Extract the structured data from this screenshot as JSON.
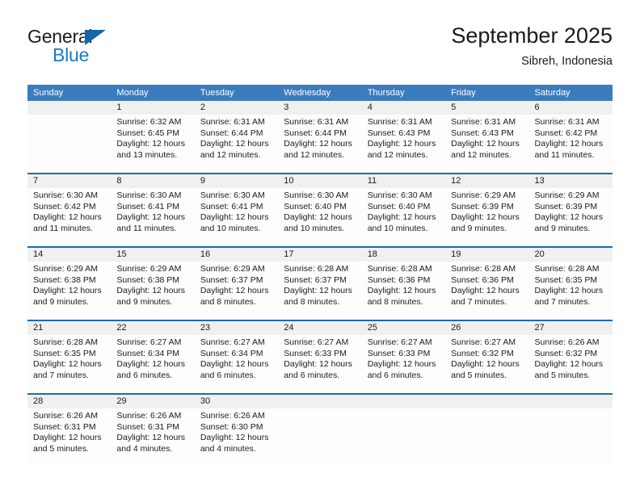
{
  "brand": {
    "name_top": "General",
    "name_bottom": "Blue"
  },
  "header": {
    "title": "September 2025",
    "subtitle": "Sibreh, Indonesia"
  },
  "colors": {
    "header_blue": "#3a7cbe",
    "separator_blue": "#1b6cb0",
    "datenum_bg": "#f0f0f0",
    "logo_blue": "#1b79c4",
    "text": "#1b1b1b"
  },
  "calendar": {
    "day_headers": [
      "Sunday",
      "Monday",
      "Tuesday",
      "Wednesday",
      "Thursday",
      "Friday",
      "Saturday"
    ],
    "labels": {
      "sunrise": "Sunrise:",
      "sunset": "Sunset:",
      "daylight": "Daylight:"
    },
    "weeks": [
      {
        "days": [
          {
            "date": "",
            "sunrise": "",
            "sunset": "",
            "daylight": "",
            "empty": true
          },
          {
            "date": "1",
            "sunrise": "Sunrise: 6:32 AM",
            "sunset": "Sunset: 6:45 PM",
            "daylight": "Daylight: 12 hours and 13 minutes."
          },
          {
            "date": "2",
            "sunrise": "Sunrise: 6:31 AM",
            "sunset": "Sunset: 6:44 PM",
            "daylight": "Daylight: 12 hours and 12 minutes."
          },
          {
            "date": "3",
            "sunrise": "Sunrise: 6:31 AM",
            "sunset": "Sunset: 6:44 PM",
            "daylight": "Daylight: 12 hours and 12 minutes."
          },
          {
            "date": "4",
            "sunrise": "Sunrise: 6:31 AM",
            "sunset": "Sunset: 6:43 PM",
            "daylight": "Daylight: 12 hours and 12 minutes."
          },
          {
            "date": "5",
            "sunrise": "Sunrise: 6:31 AM",
            "sunset": "Sunset: 6:43 PM",
            "daylight": "Daylight: 12 hours and 12 minutes."
          },
          {
            "date": "6",
            "sunrise": "Sunrise: 6:31 AM",
            "sunset": "Sunset: 6:42 PM",
            "daylight": "Daylight: 12 hours and 11 minutes."
          }
        ]
      },
      {
        "days": [
          {
            "date": "7",
            "sunrise": "Sunrise: 6:30 AM",
            "sunset": "Sunset: 6:42 PM",
            "daylight": "Daylight: 12 hours and 11 minutes."
          },
          {
            "date": "8",
            "sunrise": "Sunrise: 6:30 AM",
            "sunset": "Sunset: 6:41 PM",
            "daylight": "Daylight: 12 hours and 11 minutes."
          },
          {
            "date": "9",
            "sunrise": "Sunrise: 6:30 AM",
            "sunset": "Sunset: 6:41 PM",
            "daylight": "Daylight: 12 hours and 10 minutes."
          },
          {
            "date": "10",
            "sunrise": "Sunrise: 6:30 AM",
            "sunset": "Sunset: 6:40 PM",
            "daylight": "Daylight: 12 hours and 10 minutes."
          },
          {
            "date": "11",
            "sunrise": "Sunrise: 6:30 AM",
            "sunset": "Sunset: 6:40 PM",
            "daylight": "Daylight: 12 hours and 10 minutes."
          },
          {
            "date": "12",
            "sunrise": "Sunrise: 6:29 AM",
            "sunset": "Sunset: 6:39 PM",
            "daylight": "Daylight: 12 hours and 9 minutes."
          },
          {
            "date": "13",
            "sunrise": "Sunrise: 6:29 AM",
            "sunset": "Sunset: 6:39 PM",
            "daylight": "Daylight: 12 hours and 9 minutes."
          }
        ]
      },
      {
        "days": [
          {
            "date": "14",
            "sunrise": "Sunrise: 6:29 AM",
            "sunset": "Sunset: 6:38 PM",
            "daylight": "Daylight: 12 hours and 9 minutes."
          },
          {
            "date": "15",
            "sunrise": "Sunrise: 6:29 AM",
            "sunset": "Sunset: 6:38 PM",
            "daylight": "Daylight: 12 hours and 9 minutes."
          },
          {
            "date": "16",
            "sunrise": "Sunrise: 6:29 AM",
            "sunset": "Sunset: 6:37 PM",
            "daylight": "Daylight: 12 hours and 8 minutes."
          },
          {
            "date": "17",
            "sunrise": "Sunrise: 6:28 AM",
            "sunset": "Sunset: 6:37 PM",
            "daylight": "Daylight: 12 hours and 8 minutes."
          },
          {
            "date": "18",
            "sunrise": "Sunrise: 6:28 AM",
            "sunset": "Sunset: 6:36 PM",
            "daylight": "Daylight: 12 hours and 8 minutes."
          },
          {
            "date": "19",
            "sunrise": "Sunrise: 6:28 AM",
            "sunset": "Sunset: 6:36 PM",
            "daylight": "Daylight: 12 hours and 7 minutes."
          },
          {
            "date": "20",
            "sunrise": "Sunrise: 6:28 AM",
            "sunset": "Sunset: 6:35 PM",
            "daylight": "Daylight: 12 hours and 7 minutes."
          }
        ]
      },
      {
        "days": [
          {
            "date": "21",
            "sunrise": "Sunrise: 6:28 AM",
            "sunset": "Sunset: 6:35 PM",
            "daylight": "Daylight: 12 hours and 7 minutes."
          },
          {
            "date": "22",
            "sunrise": "Sunrise: 6:27 AM",
            "sunset": "Sunset: 6:34 PM",
            "daylight": "Daylight: 12 hours and 6 minutes."
          },
          {
            "date": "23",
            "sunrise": "Sunrise: 6:27 AM",
            "sunset": "Sunset: 6:34 PM",
            "daylight": "Daylight: 12 hours and 6 minutes."
          },
          {
            "date": "24",
            "sunrise": "Sunrise: 6:27 AM",
            "sunset": "Sunset: 6:33 PM",
            "daylight": "Daylight: 12 hours and 6 minutes."
          },
          {
            "date": "25",
            "sunrise": "Sunrise: 6:27 AM",
            "sunset": "Sunset: 6:33 PM",
            "daylight": "Daylight: 12 hours and 6 minutes."
          },
          {
            "date": "26",
            "sunrise": "Sunrise: 6:27 AM",
            "sunset": "Sunset: 6:32 PM",
            "daylight": "Daylight: 12 hours and 5 minutes."
          },
          {
            "date": "27",
            "sunrise": "Sunrise: 6:26 AM",
            "sunset": "Sunset: 6:32 PM",
            "daylight": "Daylight: 12 hours and 5 minutes."
          }
        ]
      },
      {
        "days": [
          {
            "date": "28",
            "sunrise": "Sunrise: 6:26 AM",
            "sunset": "Sunset: 6:31 PM",
            "daylight": "Daylight: 12 hours and 5 minutes."
          },
          {
            "date": "29",
            "sunrise": "Sunrise: 6:26 AM",
            "sunset": "Sunset: 6:31 PM",
            "daylight": "Daylight: 12 hours and 4 minutes."
          },
          {
            "date": "30",
            "sunrise": "Sunrise: 6:26 AM",
            "sunset": "Sunset: 6:30 PM",
            "daylight": "Daylight: 12 hours and 4 minutes."
          },
          {
            "date": "",
            "sunrise": "",
            "sunset": "",
            "daylight": "",
            "empty": true
          },
          {
            "date": "",
            "sunrise": "",
            "sunset": "",
            "daylight": "",
            "empty": true
          },
          {
            "date": "",
            "sunrise": "",
            "sunset": "",
            "daylight": "",
            "empty": true
          },
          {
            "date": "",
            "sunrise": "",
            "sunset": "",
            "daylight": "",
            "empty": true
          }
        ]
      }
    ]
  }
}
